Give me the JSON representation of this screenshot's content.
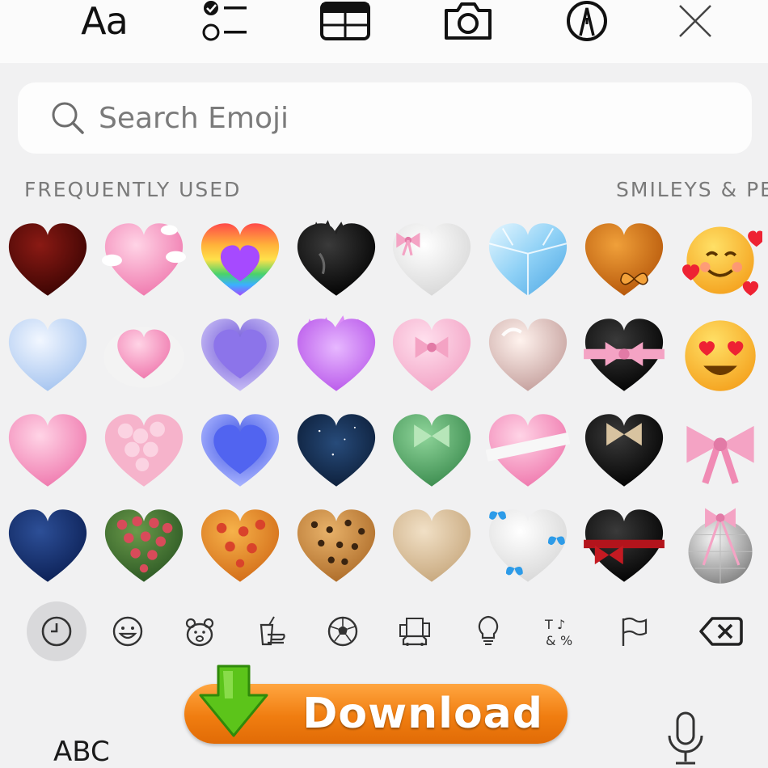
{
  "toolbar": {
    "format_label": "Aa",
    "items": [
      "format-icon",
      "checklist-icon",
      "table-icon",
      "camera-icon",
      "markup-pen-icon",
      "close-icon"
    ]
  },
  "search": {
    "placeholder": "Search Emoji",
    "value": ""
  },
  "sections": {
    "frequent": "FREQUENTLY USED",
    "smileys": "SMILEYS & PE"
  },
  "emoji_grid": [
    [
      "dark-red-heart",
      "heart-with-clouds",
      "rainbow-heart",
      "black-flaming-heart",
      "white-heart-with-pink-bow",
      "diamond-heart",
      "orange-heart-with-butterfly",
      "smiling-face-with-hearts"
    ],
    [
      "light-blue-heart",
      "pink-heart-in-clouds",
      "purple-layered-heart",
      "purple-flaming-heart",
      "pink-heart-with-bow",
      "glass-heart",
      "black-heart-with-pink-ribbon",
      "smiling-face-with-heart-eyes"
    ],
    [
      "pink-heart",
      "pink-bubble-heart",
      "blue-layered-heart",
      "starry-night-heart",
      "green-heart-with-bow",
      "bandaged-pink-heart",
      "black-heart-with-tan-bow",
      "pink-ribbon"
    ],
    [
      "navy-heart",
      "rose-heart",
      "pizza-heart",
      "leopard-heart",
      "beige-heart",
      "white-heart-with-blue-butterflies",
      "black-heart-with-red-ribbon",
      "disco-ball-with-pink-bow"
    ]
  ],
  "categories": [
    "recent-clock-icon",
    "smiley-icon",
    "animal-icon",
    "food-icon",
    "sports-ball-icon",
    "buildings-icon",
    "lightbulb-icon",
    "symbols-icon",
    "flag-icon",
    "delete-icon"
  ],
  "bottom": {
    "abc_label": "ABC",
    "download_label": "Download"
  },
  "colors": {
    "background": "#f1f1f2",
    "download_orange": "#f07d10",
    "download_arrow_green": "#5cc41a",
    "active_category_bg": "#d9d9db"
  }
}
